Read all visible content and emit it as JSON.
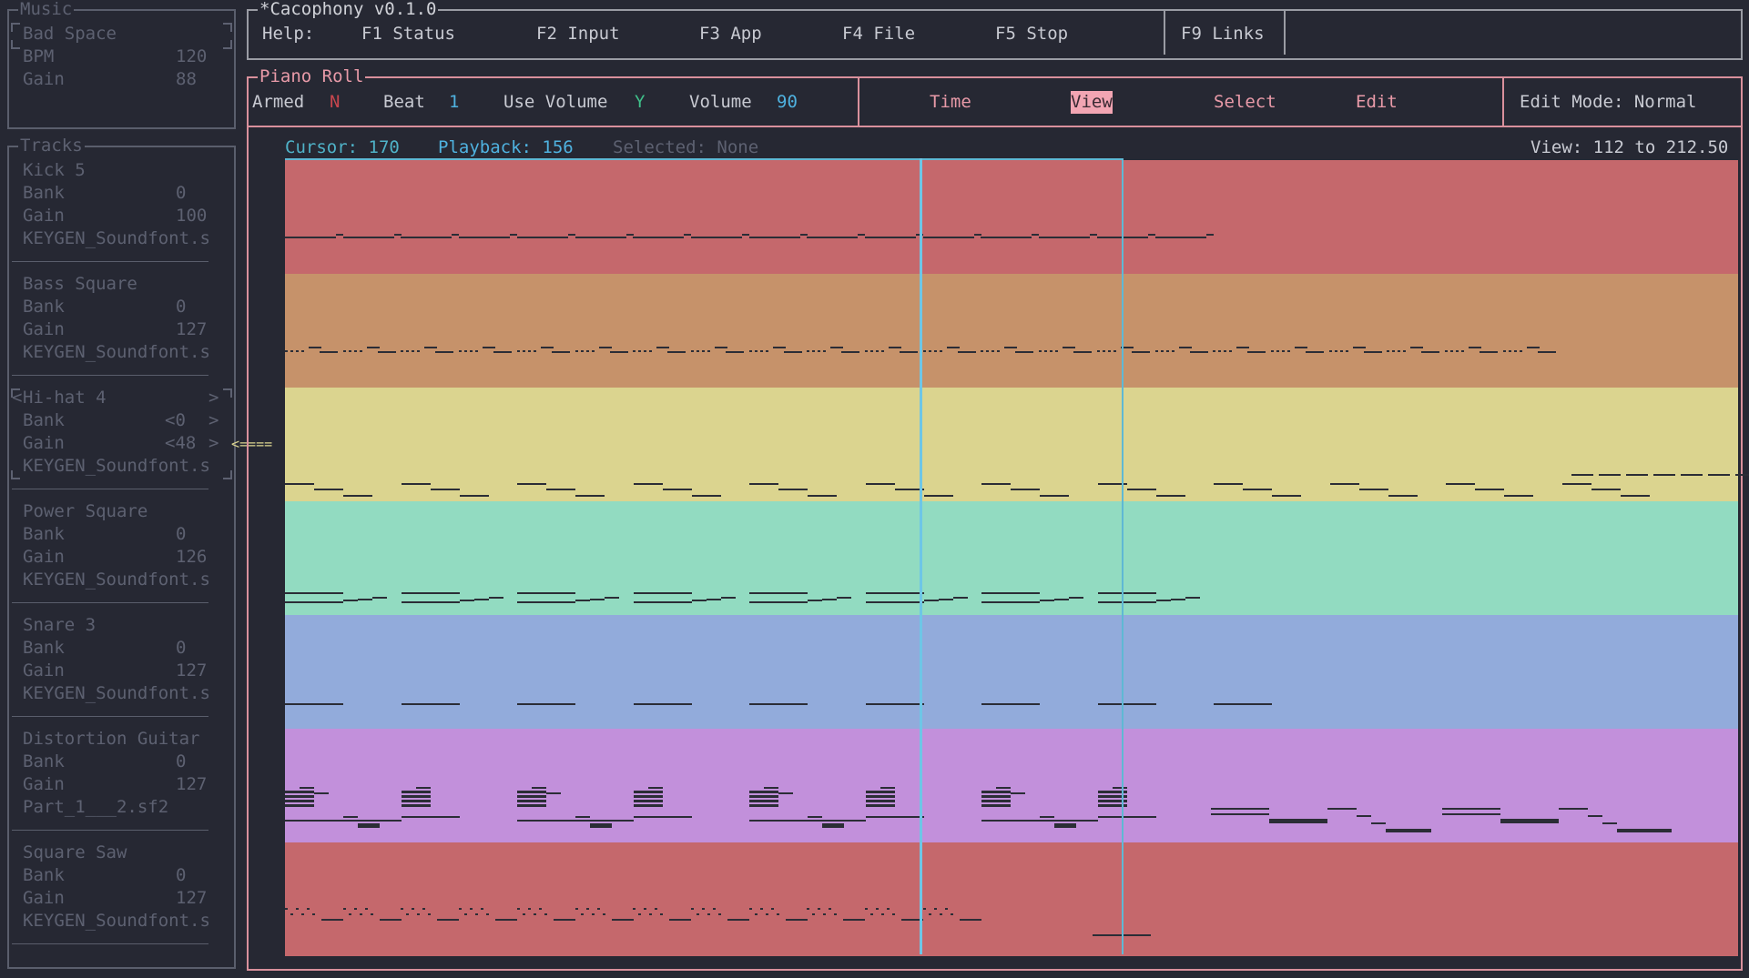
{
  "music_panel": {
    "title": "Music",
    "song_name": "Bad Space",
    "rows": [
      {
        "label": "BPM",
        "value": "120"
      },
      {
        "label": "Gain",
        "value": "88"
      }
    ]
  },
  "tracks_panel": {
    "title": "Tracks",
    "tracks": [
      {
        "name": "Kick 5",
        "bank": "0",
        "gain": "100",
        "soundfont": "KEYGEN_Soundfont.s",
        "selected": false
      },
      {
        "name": "Bass Square",
        "bank": "0",
        "gain": "127",
        "soundfont": "KEYGEN_Soundfont.s",
        "selected": false
      },
      {
        "name": "Hi-hat 4",
        "bank": "0",
        "gain": "48",
        "soundfont": "KEYGEN_Soundfont.s",
        "selected": true
      },
      {
        "name": "Power Square",
        "bank": "0",
        "gain": "126",
        "soundfont": "KEYGEN_Soundfont.s",
        "selected": false
      },
      {
        "name": "Snare 3",
        "bank": "0",
        "gain": "127",
        "soundfont": "KEYGEN_Soundfont.s",
        "selected": false
      },
      {
        "name": "Distortion Guitar",
        "bank": "0",
        "gain": "127",
        "soundfont": "Part_1___2.sf2",
        "selected": false
      },
      {
        "name": "Square Saw",
        "bank": "0",
        "gain": "127",
        "soundfont": "KEYGEN_Soundfont.s",
        "selected": false
      }
    ],
    "bank_label": "Bank",
    "gain_label": "Gain",
    "selected_arrow": "<====",
    "prev_glyph": "<",
    "next_glyph": ">"
  },
  "header": {
    "title": "*Cacophony v0.1.0",
    "help_label": "Help:",
    "keys": [
      "F1 Status",
      "F2 Input",
      "F3 App",
      "F4 File",
      "F5 Stop"
    ],
    "links_key": "F9 Links"
  },
  "piano_roll": {
    "title": "Piano Roll",
    "armed_label": "Armed",
    "armed_value": "N",
    "beat_label": "Beat",
    "beat_value": "1",
    "use_volume_label": "Use Volume",
    "use_volume_value": "Y",
    "volume_label": "Volume",
    "volume_value": "90",
    "menu": [
      "Time",
      "View",
      "Select",
      "Edit"
    ],
    "active_menu": "View",
    "edit_mode": "Edit Mode: Normal",
    "cursor_label": "Cursor: 170",
    "playback_label": "Playback: 156",
    "selected_label": "Selected: None",
    "view_range": "View: 112 to 212.50",
    "view_start": 112,
    "view_end": 212.5,
    "cursor": 170,
    "playback": 156
  },
  "lane_colors": [
    "#c5686c",
    "#c6926a",
    "#dbd48f",
    "#92dbc1",
    "#92abdb",
    "#c290db",
    "#c5686c"
  ],
  "colors": {
    "accent_pink": "#e89aa8",
    "armed_no": "#c8464e",
    "yes_green": "#3fc08a",
    "value_blue": "#4fb2e0",
    "cursor_cyan": "#5fb8d4"
  }
}
